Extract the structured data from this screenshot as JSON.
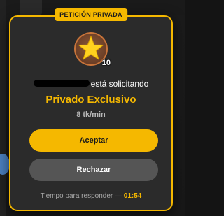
{
  "modal": {
    "badge": "PETICIÓN PRIVADA",
    "avatar": {
      "icon": "star-icon",
      "level": "10"
    },
    "request_text": "está solicitando",
    "title": "Privado Exclusivo",
    "price": "8 tk/min",
    "accept_label": "Aceptar",
    "reject_label": "Rechazar",
    "timer_label": "Tiempo para responder —",
    "timer_value": "01:54"
  },
  "colors": {
    "accent": "#f5b800",
    "panel": "#2b2b2b",
    "reject_button": "#555555"
  }
}
